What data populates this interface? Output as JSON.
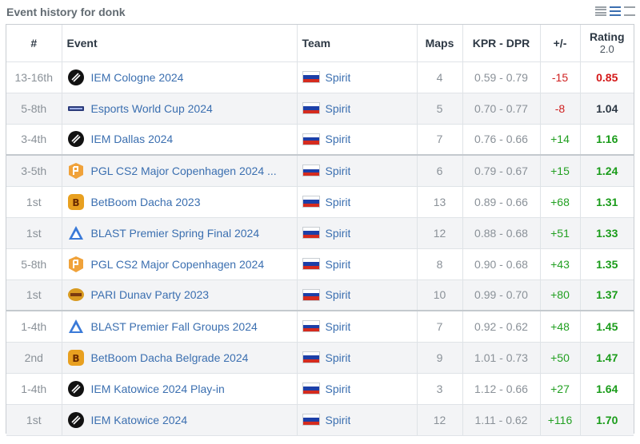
{
  "header": {
    "title": "Event history for donk",
    "toggles": [
      "compact-view",
      "list-view",
      "expanded-view"
    ]
  },
  "columns": {
    "place": "#",
    "event": "Event",
    "team": "Team",
    "maps": "Maps",
    "kd": "KPR - DPR",
    "diff": "+/-",
    "rating": "Rating",
    "rating_sub": "2.0"
  },
  "colors": {
    "link": "#3b6fb0",
    "positive": "#22a022",
    "negative": "#d02020",
    "rating_good": "#1a9c1a",
    "rating_bad": "#d41818"
  },
  "rows": [
    {
      "place": "13-16th",
      "icon": "iem-icon",
      "event": "IEM Cologne 2024",
      "team": "Spirit",
      "maps": "4",
      "kd": "0.59 - 0.79",
      "diff": "-15",
      "rating": "0.85"
    },
    {
      "place": "5-8th",
      "icon": "ewc-icon",
      "event": "Esports World Cup 2024",
      "team": "Spirit",
      "maps": "5",
      "kd": "0.70 - 0.77",
      "diff": "-8",
      "rating": "1.04"
    },
    {
      "place": "3-4th",
      "icon": "iem-icon",
      "event": "IEM Dallas 2024",
      "team": "Spirit",
      "maps": "7",
      "kd": "0.76 - 0.66",
      "diff": "+14",
      "rating": "1.16"
    },
    {
      "place": "3-5th",
      "icon": "pgl-icon",
      "event": "PGL CS2 Major Copenhagen 2024 ...",
      "team": "Spirit",
      "maps": "6",
      "kd": "0.79 - 0.67",
      "diff": "+15",
      "rating": "1.24"
    },
    {
      "place": "1st",
      "icon": "betboom-icon",
      "event": "BetBoom Dacha 2023",
      "team": "Spirit",
      "maps": "13",
      "kd": "0.89 - 0.66",
      "diff": "+68",
      "rating": "1.31"
    },
    {
      "place": "1st",
      "icon": "blast-icon",
      "event": "BLAST Premier Spring Final 2024",
      "team": "Spirit",
      "maps": "12",
      "kd": "0.88 - 0.68",
      "diff": "+51",
      "rating": "1.33"
    },
    {
      "place": "5-8th",
      "icon": "pgl-icon",
      "event": "PGL CS2 Major Copenhagen 2024",
      "team": "Spirit",
      "maps": "8",
      "kd": "0.90 - 0.68",
      "diff": "+43",
      "rating": "1.35"
    },
    {
      "place": "1st",
      "icon": "pari-icon",
      "event": "PARI Dunav Party 2023",
      "team": "Spirit",
      "maps": "10",
      "kd": "0.99 - 0.70",
      "diff": "+80",
      "rating": "1.37"
    },
    {
      "place": "1-4th",
      "icon": "blast-icon",
      "event": "BLAST Premier Fall Groups 2024",
      "team": "Spirit",
      "maps": "7",
      "kd": "0.92 - 0.62",
      "diff": "+48",
      "rating": "1.45"
    },
    {
      "place": "2nd",
      "icon": "betboom-icon",
      "event": "BetBoom Dacha Belgrade 2024",
      "team": "Spirit",
      "maps": "9",
      "kd": "1.01 - 0.73",
      "diff": "+50",
      "rating": "1.47"
    },
    {
      "place": "1-4th",
      "icon": "iem-icon",
      "event": "IEM Katowice 2024 Play-in",
      "team": "Spirit",
      "maps": "3",
      "kd": "1.12 - 0.66",
      "diff": "+27",
      "rating": "1.64"
    },
    {
      "place": "1st",
      "icon": "iem-icon",
      "event": "IEM Katowice 2024",
      "team": "Spirit",
      "maps": "12",
      "kd": "1.11 - 0.62",
      "diff": "+116",
      "rating": "1.70"
    }
  ]
}
